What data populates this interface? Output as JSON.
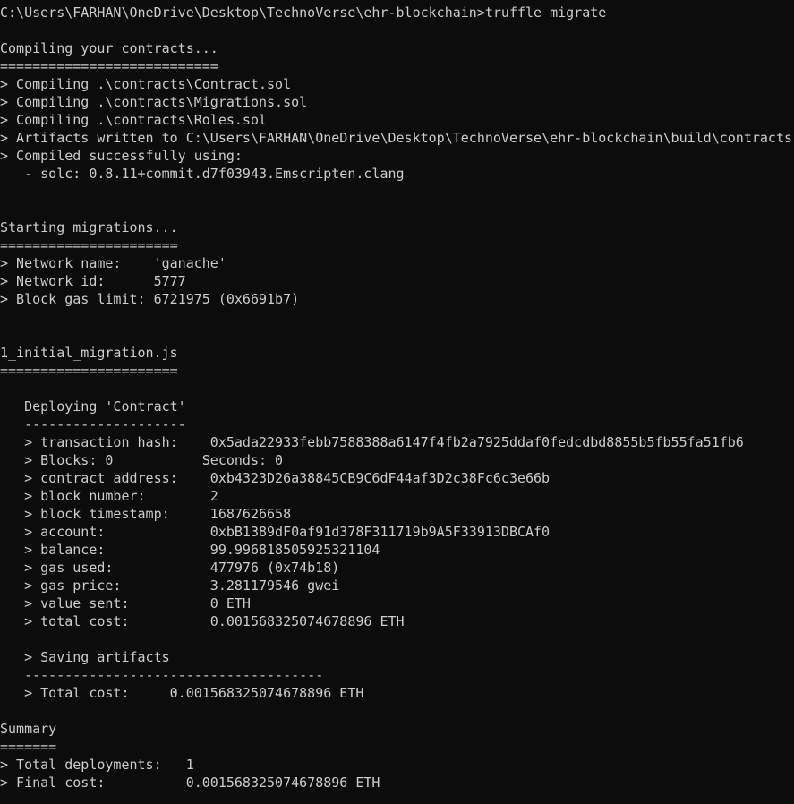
{
  "terminal": {
    "title": "truffle migrate",
    "background_color": "#0c0c0c",
    "foreground_color": "#cccccc",
    "prompt_path": "C:\\Users\\FARHAN\\OneDrive\\Desktop\\TechnoVerse\\ehr-blockchain",
    "command": "truffle migrate",
    "lines": [
      "C:\\Users\\FARHAN\\OneDrive\\Desktop\\TechnoVerse\\ehr-blockchain>truffle migrate",
      "",
      "Compiling your contracts...",
      "===========================",
      "> Compiling .\\contracts\\Contract.sol",
      "> Compiling .\\contracts\\Migrations.sol",
      "> Compiling .\\contracts\\Roles.sol",
      "> Artifacts written to C:\\Users\\FARHAN\\OneDrive\\Desktop\\TechnoVerse\\ehr-blockchain\\build\\contracts",
      "> Compiled successfully using:",
      "   - solc: 0.8.11+commit.d7f03943.Emscripten.clang",
      "",
      "",
      "Starting migrations...",
      "======================",
      "> Network name:    'ganache'",
      "> Network id:      5777",
      "> Block gas limit: 6721975 (0x6691b7)",
      "",
      "",
      "1_initial_migration.js",
      "======================",
      "",
      "   Deploying 'Contract'",
      "   --------------------",
      "   > transaction hash:    0x5ada22933febb7588388a6147f4fb2a7925ddaf0fedcdbd8855b5fb55fa51fb6",
      "   > Blocks: 0           Seconds: 0",
      "   > contract address:    0xb4323D26a38845CB9C6dF44af3D2c38Fc6c3e66b",
      "   > block number:        2",
      "   > block timestamp:     1687626658",
      "   > account:             0xbB1389dF0af91d378F311719b9A5F33913DBCAf0",
      "   > balance:             99.996818505925321104",
      "   > gas used:            477976 (0x74b18)",
      "   > gas price:           3.281179546 gwei",
      "   > value sent:          0 ETH",
      "   > total cost:          0.001568325074678896 ETH",
      "",
      "   > Saving artifacts",
      "   -------------------------------------",
      "   > Total cost:     0.001568325074678896 ETH",
      "",
      "Summary",
      "=======",
      "> Total deployments:   1",
      "> Final cost:          0.001568325074678896 ETH"
    ],
    "details": {
      "compiling": {
        "heading": "Compiling your contracts...",
        "files": [
          ".\\contracts\\Contract.sol",
          ".\\contracts\\Migrations.sol",
          ".\\contracts\\Roles.sol"
        ],
        "artifacts_path": "C:\\Users\\FARHAN\\OneDrive\\Desktop\\TechnoVerse\\ehr-blockchain\\build\\contracts",
        "status": "Compiled successfully using:",
        "solc_version": "0.8.11+commit.d7f03943.Emscripten.clang"
      },
      "migrations": {
        "heading": "Starting migrations...",
        "network_name": "'ganache'",
        "network_id": "5777",
        "block_gas_limit": "6721975 (0x6691b7)"
      },
      "migration_file": "1_initial_migration.js",
      "deployment": {
        "contract_name": "Deploying 'Contract'",
        "transaction_hash": "0x5ada22933febb7588388a6147f4fb2a7925ddaf0fedcdbd8855b5fb55fa51fb6",
        "blocks": "0",
        "seconds": "0",
        "contract_address": "0xb4323D26a38845CB9C6dF44af3D2c38Fc6c3e66b",
        "block_number": "2",
        "block_timestamp": "1687626658",
        "account": "0xbB1389dF0af91d378F311719b9A5F33913DBCAf0",
        "balance": "99.996818505925321104",
        "gas_used": "477976 (0x74b18)",
        "gas_price": "3.281179546 gwei",
        "value_sent": "0 ETH",
        "total_cost": "0.001568325074678896 ETH",
        "saving_artifacts": "Saving artifacts",
        "section_total_cost": "0.001568325074678896 ETH"
      },
      "summary": {
        "heading": "Summary",
        "total_deployments": "1",
        "final_cost": "0.001568325074678896 ETH"
      }
    }
  }
}
